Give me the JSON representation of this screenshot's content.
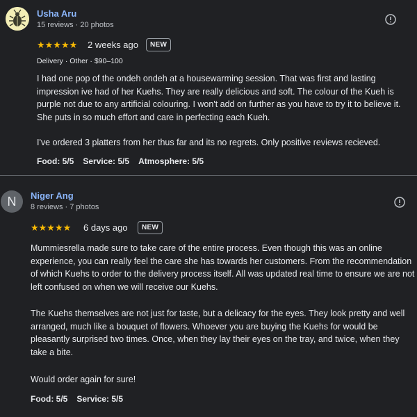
{
  "reviews": [
    {
      "author": "Usha Aru",
      "stats": "15 reviews · 20 photos",
      "stars": "★★★★★",
      "time_ago": "2 weeks ago",
      "badge": "NEW",
      "tags": "Delivery · Other · $90–100",
      "paragraphs": [
        "I had one pop of the ondeh ondeh at a housewarming session. That was first and lasting impression ive had of her Kuehs. They are really delicious and soft. The colour of the Kueh is purple not due to any artificial colouring. I won't add on further as you have to try it to believe it. She puts in so much effort and care in perfecting each Kueh.",
        "I've ordered 3 platters from her thus far and its no regrets. Only positive reviews recieved."
      ],
      "ratings": [
        "Food: 5/5",
        "Service: 5/5",
        "Atmosphere: 5/5"
      ]
    },
    {
      "author": "Niger Ang",
      "avatar_initial": "N",
      "stats": "8 reviews · 7 photos",
      "stars": "★★★★★",
      "time_ago": "6 days ago",
      "badge": "NEW",
      "paragraphs": [
        "Mummiesrella made sure to take care of the entire process. Even though this was an online experience, you can really feel the care she has towards her customers. From the recommendation of which Kuehs to order to the delivery process itself. All was updated real time to ensure we are not left confused on when we will receive our Kuehs.",
        "The Kuehs themselves are not just for taste, but a delicacy for the eyes. They look pretty and well arranged, much like a bouquet of flowers. Whoever you are buying the Kuehs for would be pleasantly surprised two times. Once, when they lay their eyes on the tray, and twice, when they take a bite.",
        "Would order again for sure!"
      ],
      "ratings": [
        "Food: 5/5",
        "Service: 5/5"
      ]
    }
  ]
}
